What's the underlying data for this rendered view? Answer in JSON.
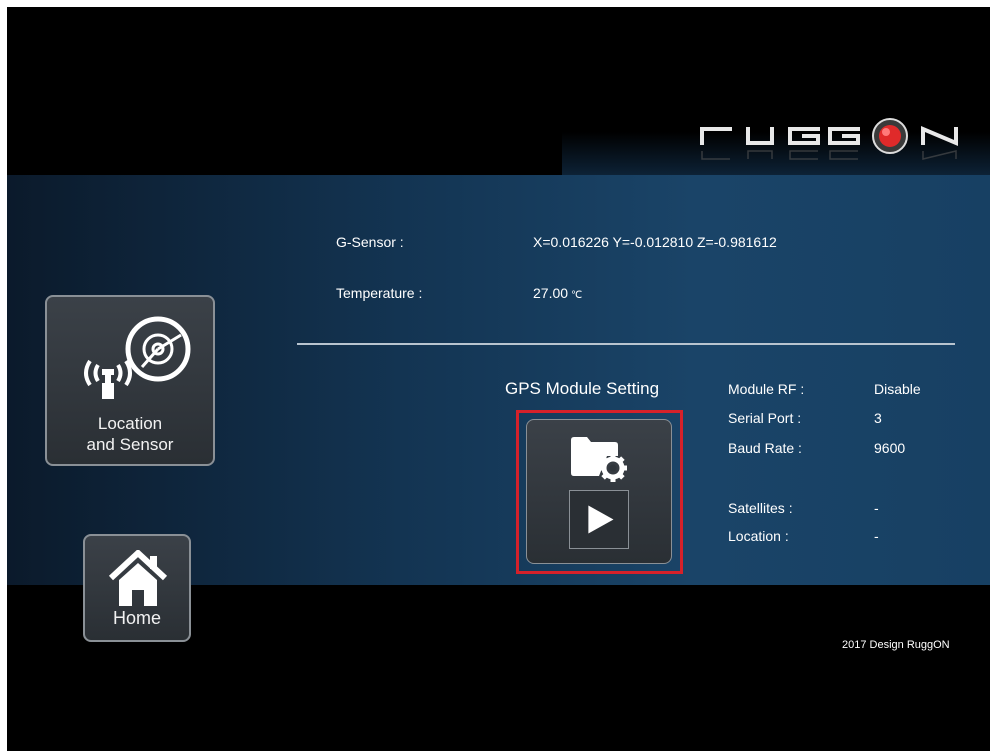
{
  "sidebar": {
    "location_tile": {
      "label_line1": "Location",
      "label_line2": "and Sensor",
      "icon": "antenna-radar-icon"
    },
    "home_tile": {
      "label": "Home",
      "icon": "home-icon"
    }
  },
  "sensor": {
    "gsensor_label": "G-Sensor :",
    "gsensor_value": "X=0.016226 Y=-0.012810 Z=-0.981612",
    "temperature_label": "Temperature :",
    "temperature_value": "27.00",
    "temperature_unit": "℃"
  },
  "gps": {
    "title": "GPS Module Setting",
    "settings_icon": "folder-gear-icon",
    "play_icon": "play-icon",
    "info": {
      "module_rf_label": "Module RF :",
      "module_rf_value": "Disable",
      "serial_port_label": "Serial Port :",
      "serial_port_value": "3",
      "baud_rate_label": "Baud Rate :",
      "baud_rate_value": "9600",
      "satellites_label": "Satellites :",
      "satellites_value": "-",
      "location_label": "Location :",
      "location_value": "-"
    }
  },
  "footer": {
    "text": "2017 Design RuggON"
  },
  "colors": {
    "accent_red": "#d6212a",
    "panel_blue": "#1a4468",
    "tile_gray": "#2f353b"
  }
}
